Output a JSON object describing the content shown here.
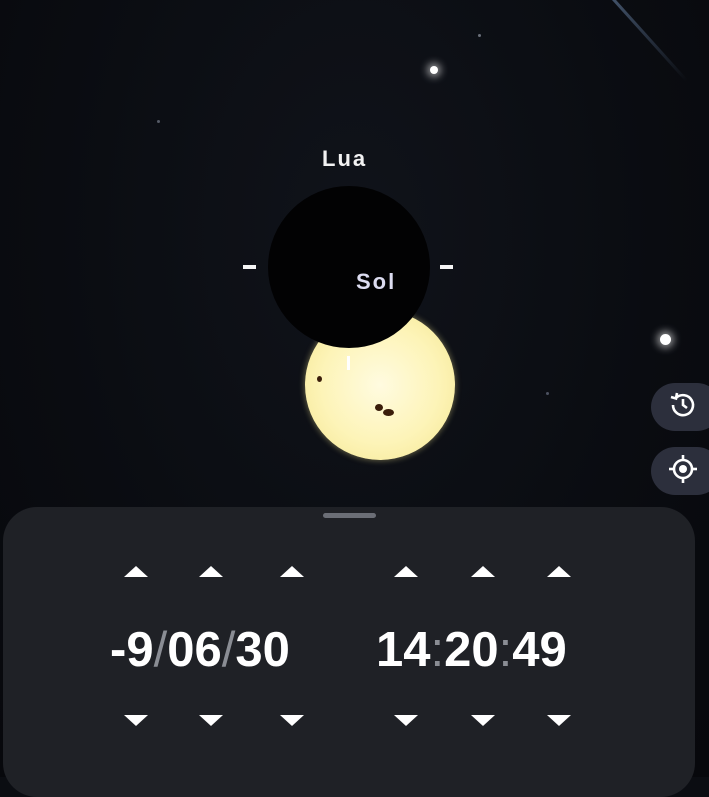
{
  "sky": {
    "moon_label": "Lua",
    "sun_label": "Sol"
  },
  "colors": {
    "panel_bg": "#1f2126",
    "side_button_bg": "#2c2f3c",
    "sun": "#fdf4b8",
    "moon": "#020203",
    "text": "#ffffff",
    "separator": "#8a8d94"
  },
  "side_buttons": [
    {
      "name": "history",
      "icon": "history-icon"
    },
    {
      "name": "locate",
      "icon": "crosshair-icon"
    }
  ],
  "date": {
    "year": "-9",
    "month": "06",
    "day": "30",
    "separator": "/"
  },
  "time": {
    "hour": "14",
    "minute": "20",
    "second": "49",
    "separator": ":"
  }
}
